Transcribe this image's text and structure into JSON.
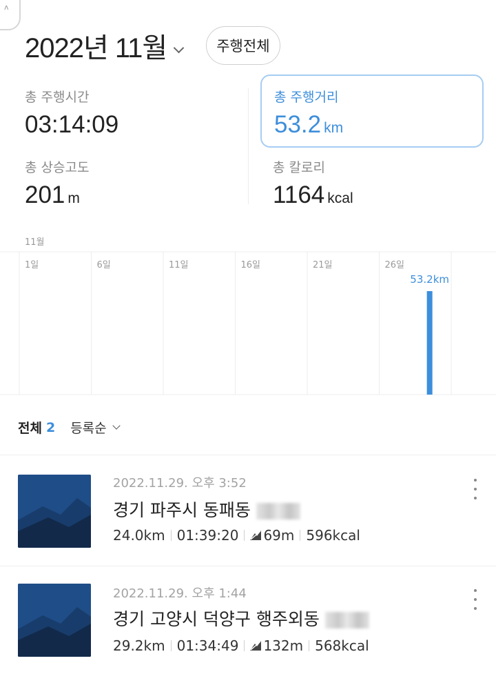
{
  "header": {
    "month_title": "2022년 11월",
    "filter_button": "주행전체"
  },
  "stats": {
    "total_time": {
      "label": "총 주행시간",
      "value": "03:14:09"
    },
    "total_distance": {
      "label": "총 주행거리",
      "value": "53.2",
      "unit": "km"
    },
    "total_elevation": {
      "label": "총 상승고도",
      "value": "201",
      "unit": "m"
    },
    "total_calories": {
      "label": "총 칼로리",
      "value": "1164",
      "unit": "kcal"
    }
  },
  "chart_month_label": "11월",
  "chart_data": {
    "type": "bar",
    "x_tick_labels": [
      "1일",
      "6일",
      "11일",
      "16일",
      "21일",
      "26일"
    ],
    "x": [
      29
    ],
    "values": [
      53.2
    ],
    "value_label": "53.2km",
    "unit": "km",
    "bar_color": "#3d8edb"
  },
  "list": {
    "all_label": "전체",
    "count": "2",
    "sort_label": "등록순"
  },
  "rides": [
    {
      "date": "2022.11.29. 오후 3:52",
      "address": "경기 파주시 동패동",
      "distance": "24.0km",
      "duration": "01:39:20",
      "elevation": "69m",
      "calories": "596kcal"
    },
    {
      "date": "2022.11.29. 오후 1:44",
      "address": "경기 고양시 덕양구 행주외동",
      "distance": "29.2km",
      "duration": "01:34:49",
      "elevation": "132m",
      "calories": "568kcal"
    }
  ]
}
